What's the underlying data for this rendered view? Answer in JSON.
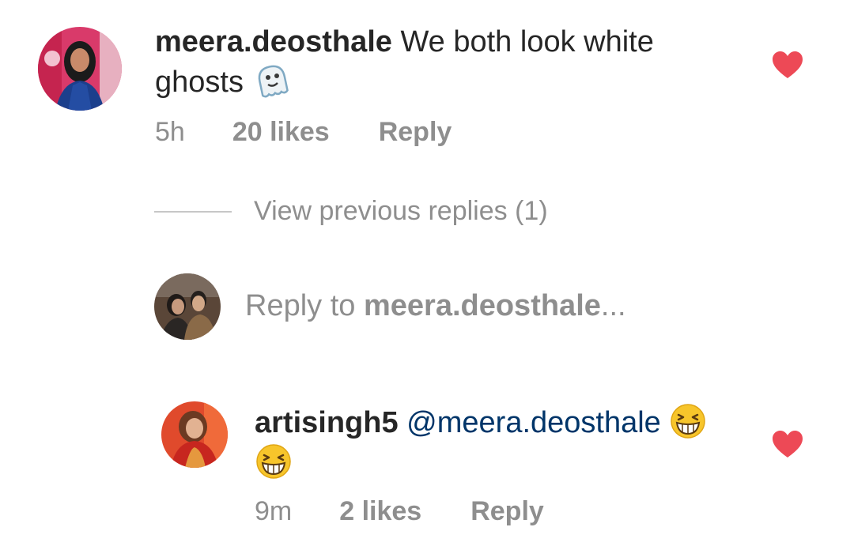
{
  "comment": {
    "username": "meera.deosthale",
    "text_line1": "We both look white",
    "text_line2": "ghosts",
    "emoji": "ghost-emoji",
    "time": "5h",
    "likes": "20 likes",
    "reply_label": "Reply",
    "liked": true
  },
  "view_previous_replies": "View previous replies (1)",
  "reply_box": {
    "prefix": "Reply to ",
    "target": "meera.deosthale",
    "suffix": "..."
  },
  "reply": {
    "username": "artisingh5",
    "mention": "@meera.deosthale",
    "emoji": "grinning-squinting-face-emoji",
    "time": "9m",
    "likes": "2 likes",
    "reply_label": "Reply",
    "liked": true
  },
  "colors": {
    "text": "#262626",
    "secondary": "#8e8e8e",
    "mention": "#003569",
    "heart": "#ed4956"
  }
}
